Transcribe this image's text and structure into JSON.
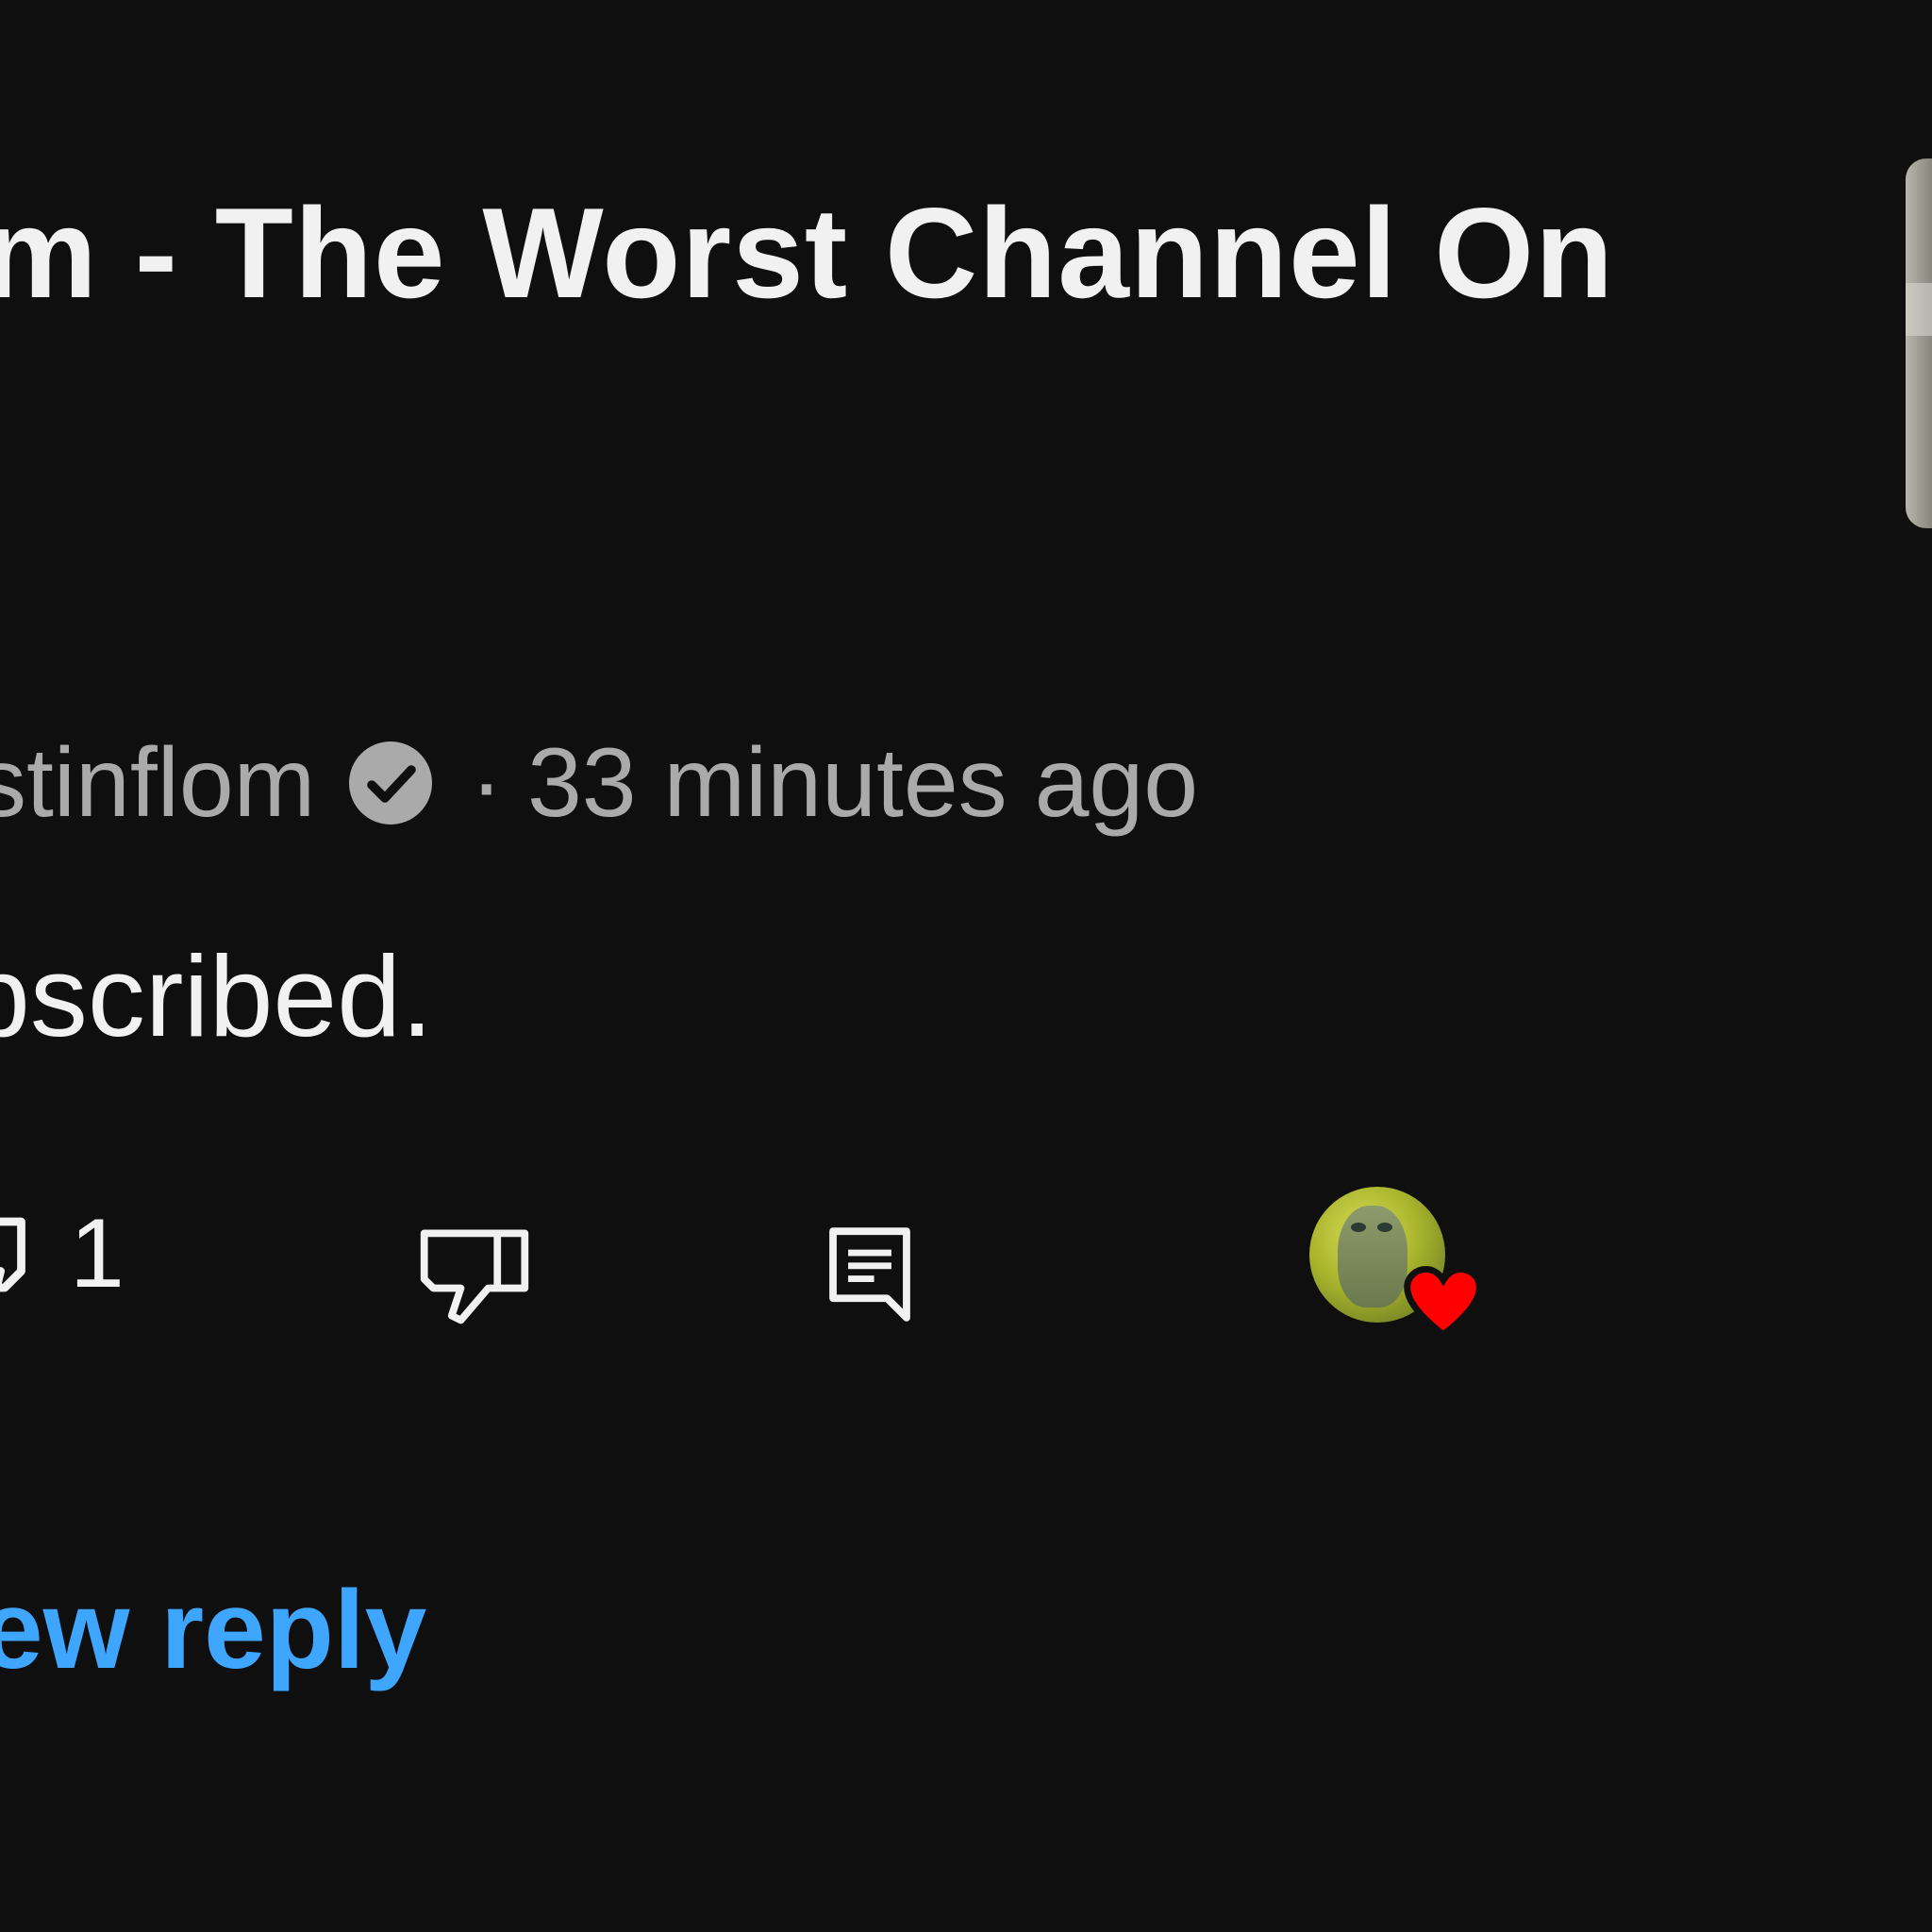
{
  "video": {
    "title": "m - The Worst Channel On"
  },
  "comment": {
    "author": "stinflom",
    "separator": "·",
    "timestamp": "33 minutes ago",
    "text": "bscribed."
  },
  "actions": {
    "like_count": "1"
  },
  "replies": {
    "link_text": "ew reply"
  },
  "colors": {
    "background": "#0f0f10",
    "primary_text": "#f1f1f1",
    "secondary_text": "#aaaaaa",
    "link": "#3ea6ff",
    "heart": "#ff0000"
  },
  "icons": {
    "verified": "verified-check-icon",
    "like": "thumbs-up-icon",
    "dislike": "thumbs-down-icon",
    "reply": "comment-reply-icon",
    "heart": "heart-icon"
  }
}
